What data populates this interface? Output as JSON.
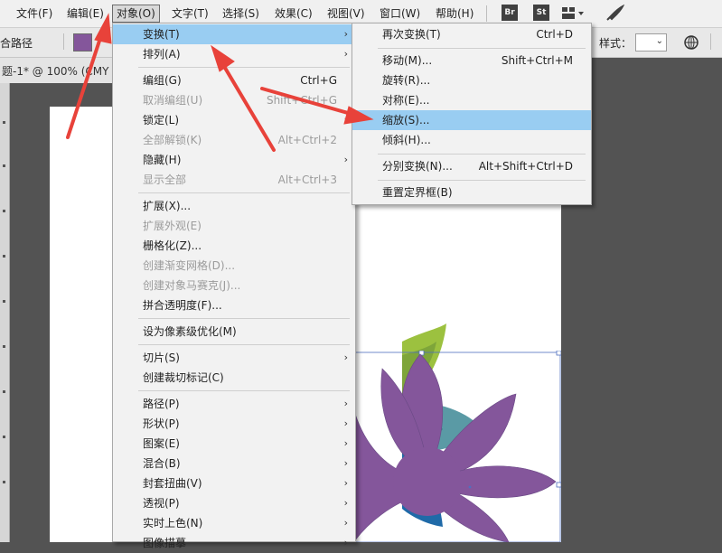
{
  "menubar": {
    "items": [
      "文件(F)",
      "编辑(E)",
      "对象(O)",
      "文字(T)",
      "选择(S)",
      "效果(C)",
      "视图(V)",
      "窗口(W)",
      "帮助(H)"
    ],
    "apps": [
      "Br",
      "St"
    ]
  },
  "controlbar": {
    "path_label": "合路径",
    "style_label": "样式："
  },
  "document": {
    "tab_title": "题-1* @ 100% (CMY"
  },
  "object_menu": {
    "items": [
      {
        "label": "变换(T)",
        "shortcut": "",
        "submenu": true,
        "disabled": false,
        "highlight": true
      },
      {
        "label": "排列(A)",
        "shortcut": "",
        "submenu": true,
        "disabled": false
      },
      {
        "label": "编组(G)",
        "shortcut": "Ctrl+G",
        "submenu": false,
        "disabled": false
      },
      {
        "label": "取消编组(U)",
        "shortcut": "Shift+Ctrl+G",
        "submenu": false,
        "disabled": true
      },
      {
        "label": "锁定(L)",
        "shortcut": "",
        "submenu": true,
        "disabled": false
      },
      {
        "label": "全部解锁(K)",
        "shortcut": "Alt+Ctrl+2",
        "submenu": false,
        "disabled": true
      },
      {
        "label": "隐藏(H)",
        "shortcut": "",
        "submenu": true,
        "disabled": false
      },
      {
        "label": "显示全部",
        "shortcut": "Alt+Ctrl+3",
        "submenu": false,
        "disabled": true
      },
      {
        "label": "扩展(X)...",
        "shortcut": "",
        "submenu": false,
        "disabled": false
      },
      {
        "label": "扩展外观(E)",
        "shortcut": "",
        "submenu": false,
        "disabled": true
      },
      {
        "label": "栅格化(Z)...",
        "shortcut": "",
        "submenu": false,
        "disabled": false
      },
      {
        "label": "创建渐变网格(D)...",
        "shortcut": "",
        "submenu": false,
        "disabled": true
      },
      {
        "label": "创建对象马赛克(J)...",
        "shortcut": "",
        "submenu": false,
        "disabled": true
      },
      {
        "label": "拼合透明度(F)...",
        "shortcut": "",
        "submenu": false,
        "disabled": false
      },
      {
        "label": "设为像素级优化(M)",
        "shortcut": "",
        "submenu": false,
        "disabled": false
      },
      {
        "label": "切片(S)",
        "shortcut": "",
        "submenu": true,
        "disabled": false
      },
      {
        "label": "创建裁切标记(C)",
        "shortcut": "",
        "submenu": false,
        "disabled": false
      },
      {
        "label": "路径(P)",
        "shortcut": "",
        "submenu": true,
        "disabled": false
      },
      {
        "label": "形状(P)",
        "shortcut": "",
        "submenu": true,
        "disabled": false
      },
      {
        "label": "图案(E)",
        "shortcut": "",
        "submenu": true,
        "disabled": false
      },
      {
        "label": "混合(B)",
        "shortcut": "",
        "submenu": true,
        "disabled": false
      },
      {
        "label": "封套扭曲(V)",
        "shortcut": "",
        "submenu": true,
        "disabled": false
      },
      {
        "label": "透视(P)",
        "shortcut": "",
        "submenu": true,
        "disabled": false
      },
      {
        "label": "实时上色(N)",
        "shortcut": "",
        "submenu": true,
        "disabled": false
      },
      {
        "label": "图像描摹",
        "shortcut": "",
        "submenu": true,
        "disabled": false
      }
    ]
  },
  "transform_menu": {
    "items": [
      {
        "label": "再次变换(T)",
        "shortcut": "Ctrl+D"
      },
      {
        "label": "移动(M)...",
        "shortcut": "Shift+Ctrl+M"
      },
      {
        "label": "旋转(R)...",
        "shortcut": ""
      },
      {
        "label": "对称(E)...",
        "shortcut": ""
      },
      {
        "label": "缩放(S)...",
        "shortcut": "",
        "highlight": true
      },
      {
        "label": "倾斜(H)...",
        "shortcut": ""
      },
      {
        "label": "分别变换(N)...",
        "shortcut": "Alt+Shift+Ctrl+D"
      },
      {
        "label": "重置定界框(B)",
        "shortcut": ""
      }
    ]
  },
  "colors": {
    "menu_highlight": "#99cdf2",
    "annotation_arrow": "#e8423a",
    "petal_purple": "#84569b",
    "petal_green": "#9cc13f",
    "petal_teal": "#5a9aa5",
    "petal_blue": "#1f6aa8"
  }
}
